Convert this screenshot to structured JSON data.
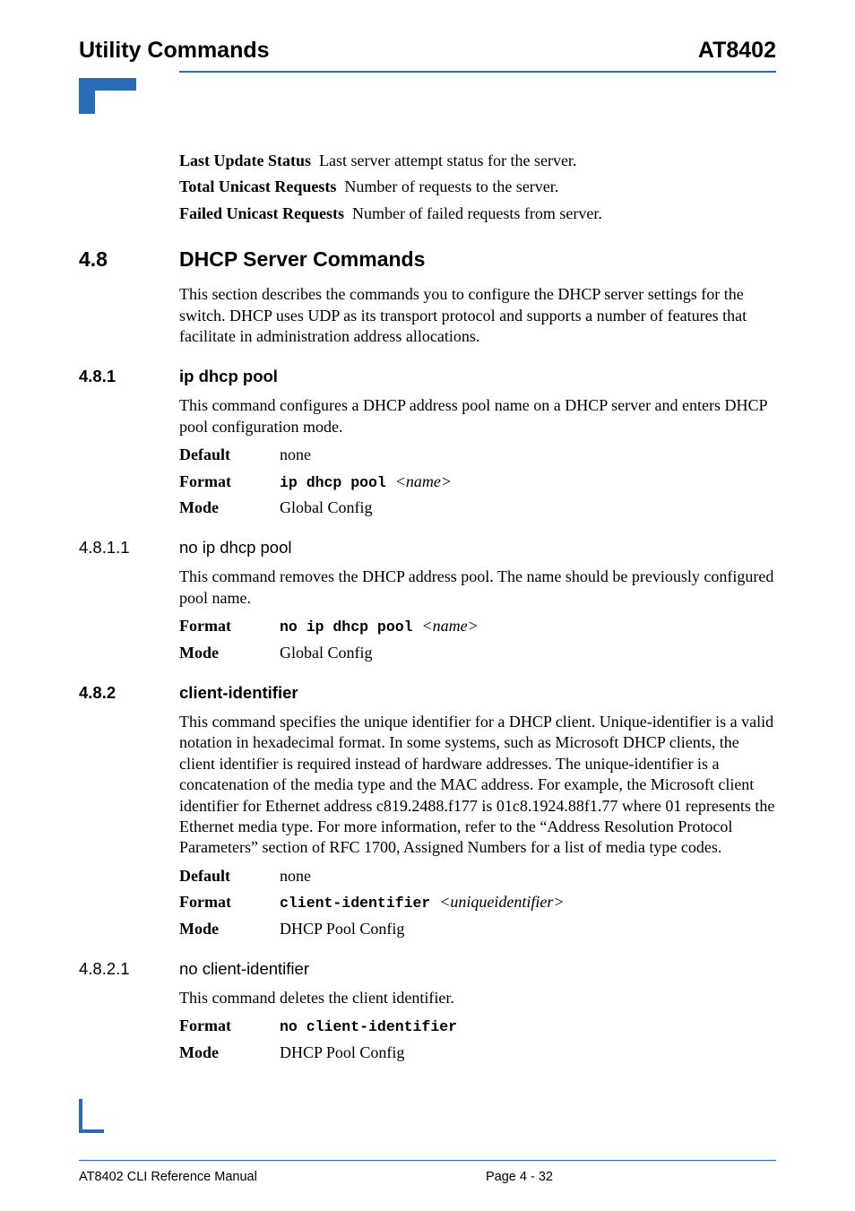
{
  "header": {
    "left": "Utility Commands",
    "right": "AT8402"
  },
  "defs": {
    "lastUpdate": {
      "term": "Last Update Status",
      "desc": "Last server attempt status for the server."
    },
    "totalUnicast": {
      "term": "Total Unicast Requests",
      "desc": "Number of requests to the server."
    },
    "failedUnicast": {
      "term": "Failed Unicast Requests",
      "desc": "Number of failed requests from server."
    }
  },
  "s48": {
    "num": "4.8",
    "title": "DHCP Server Commands",
    "intro": "This section describes the commands you to configure the DHCP server settings for the switch. DHCP uses UDP as its transport protocol and supports a number of features that facilitate in administration address allocations."
  },
  "s481": {
    "num": "4.8.1",
    "title": "ip dhcp pool",
    "intro": "This command configures a DHCP address pool name on a DHCP server and enters DHCP pool configuration mode.",
    "default": {
      "k": "Default",
      "v": "none"
    },
    "format": {
      "k": "Format",
      "cmd": "ip dhcp pool ",
      "arg": "<name>"
    },
    "mode": {
      "k": "Mode",
      "v": "Global Config"
    }
  },
  "s4811": {
    "num": "4.8.1.1",
    "title": "no ip dhcp pool",
    "intro": "This command removes the DHCP address pool. The name should be previously configured pool name.",
    "format": {
      "k": "Format",
      "cmd": "no ip dhcp pool ",
      "arg": "<name>"
    },
    "mode": {
      "k": "Mode",
      "v": "Global Config"
    }
  },
  "s482": {
    "num": "4.8.2",
    "title": "client-identifier",
    "intro": "This command specifies the unique identifier for a DHCP client. Unique-identifier is a valid notation in hexadecimal format. In some systems, such as Microsoft DHCP clients, the client identifier is required instead of hardware addresses. The unique-identifier is a concatenation of the media type and the MAC address. For example, the Microsoft client identifier for Ethernet address c819.2488.f177 is 01c8.1924.88f1.77 where 01 represents the Ethernet media type. For more information, refer to the “Address Resolution Protocol Parameters” section of RFC 1700, Assigned Numbers for a list of media type codes.",
    "default": {
      "k": "Default",
      "v": "none"
    },
    "format": {
      "k": "Format",
      "cmd": "client-identifier ",
      "arg": "<uniqueidentifier>"
    },
    "mode": {
      "k": "Mode",
      "v": "DHCP Pool Config"
    }
  },
  "s4821": {
    "num": "4.8.2.1",
    "title": "no client-identifier",
    "intro": "This command deletes the client identifier.",
    "format": {
      "k": "Format",
      "cmd": "no client-identifier"
    },
    "mode": {
      "k": "Mode",
      "v": "DHCP Pool Config"
    }
  },
  "footer": {
    "left": "AT8402 CLI Reference Manual",
    "center": "Page 4 - 32"
  }
}
